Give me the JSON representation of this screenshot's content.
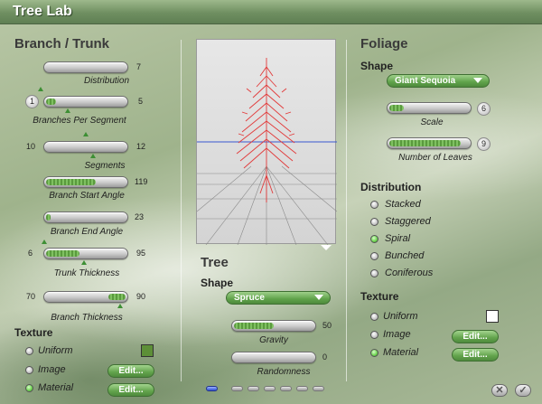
{
  "window": {
    "title": "Tree Lab"
  },
  "branch": {
    "title": "Branch / Trunk",
    "distribution": {
      "label": "Distribution",
      "value": "7",
      "fill": 0.0
    },
    "branches_per_segment": {
      "label": "Branches Per Segment",
      "min": "1",
      "max": "5",
      "fill": 0.12
    },
    "segments": {
      "label": "Segments",
      "min": "10",
      "max": "12",
      "fill": 0.0
    },
    "branch_start_angle": {
      "label": "Branch Start Angle",
      "value": "119",
      "fill": 0.62
    },
    "branch_end_angle": {
      "label": "Branch End Angle",
      "value": "23",
      "fill": 0.06
    },
    "trunk_thickness": {
      "label": "Trunk Thickness",
      "min": "6",
      "max": "95",
      "fill": 0.42
    },
    "branch_thickness": {
      "label": "Branch Thickness",
      "min": "70",
      "max": "90",
      "fill": 0.22
    }
  },
  "branch_texture": {
    "title": "Texture",
    "options": [
      "Uniform",
      "Image",
      "Material"
    ],
    "selected": "Material",
    "swatch_color": "#5d8f38",
    "edit_label": "Edit..."
  },
  "tree": {
    "title": "Tree",
    "shape_label": "Shape",
    "shape_value": "Spruce",
    "gravity": {
      "label": "Gravity",
      "value": "50",
      "fill": 0.5
    },
    "randomness": {
      "label": "Randomness",
      "value": "0",
      "fill": 0.0
    }
  },
  "foliage": {
    "title": "Foliage",
    "shape_label": "Shape",
    "shape_value": "Giant Sequoia",
    "scale": {
      "label": "Scale",
      "value": "6",
      "fill": 0.18
    },
    "number_of_leaves": {
      "label": "Number of Leaves",
      "value": "9",
      "fill": 0.9
    }
  },
  "distribution": {
    "title": "Distribution",
    "options": [
      "Stacked",
      "Staggered",
      "Spiral",
      "Bunched",
      "Coniferous"
    ],
    "selected": "Spiral"
  },
  "foliage_texture": {
    "title": "Texture",
    "options": [
      "Uniform",
      "Image",
      "Material"
    ],
    "selected": "Material",
    "swatch_color": "#ffffff",
    "edit_label": "Edit..."
  },
  "colors": {
    "accent": "#5fa24a",
    "tree_preview": "#e23a3a",
    "horizon": "#3a58d0"
  },
  "icons": {
    "close": "close-icon",
    "confirm": "checkmark-icon"
  },
  "pager": {
    "count": 6,
    "active": 0
  }
}
